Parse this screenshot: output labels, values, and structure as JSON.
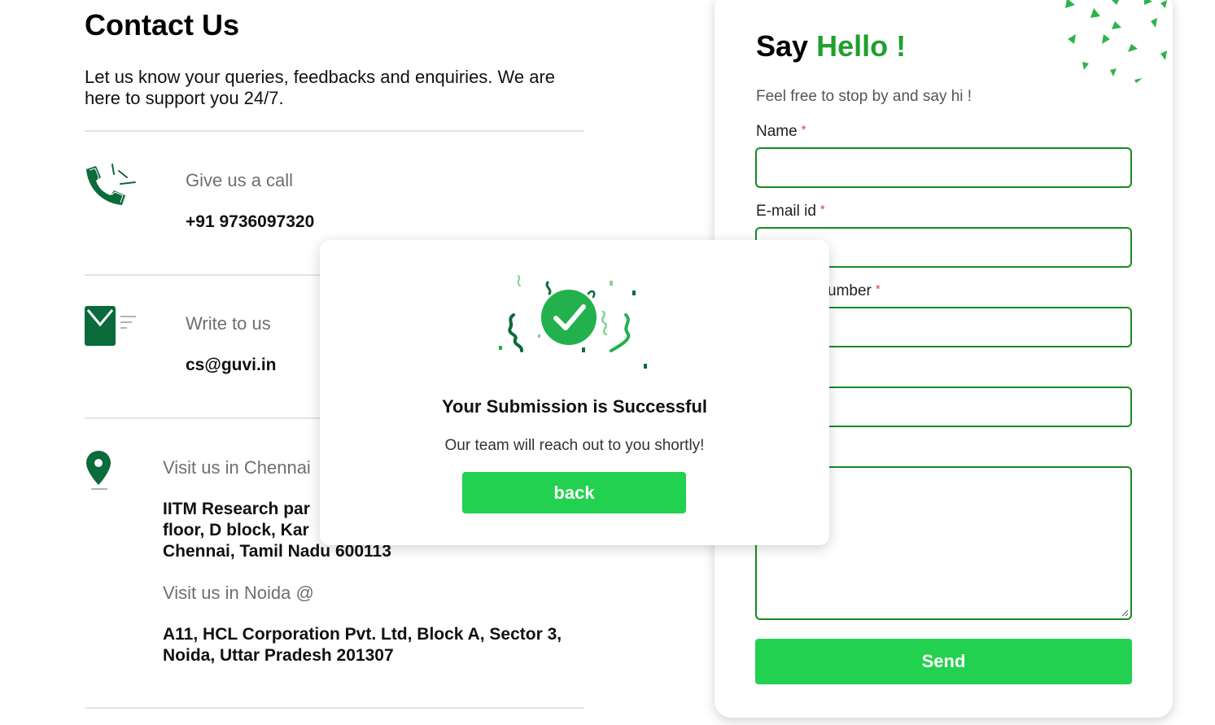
{
  "contact": {
    "title": "Contact Us",
    "intro": "Let us know your queries, feedbacks and enquiries. We are here to support you 24/7.",
    "call_label": "Give us a call",
    "call_value": "+91 9736097320",
    "write_label": "Write to us",
    "write_value": "cs@guvi.in",
    "chennai_label": "Visit us in Chennai",
    "chennai_address_line1": "IITM Research par",
    "chennai_address_line2": "floor, D block, Kar",
    "chennai_address_line3": "Chennai, Tamil Nadu 600113",
    "noida_label": "Visit us in Noida @",
    "noida_address": "A11, HCL Corporation Pvt. Ltd, Block A, Sector 3, Noida, Uttar Pradesh 201307"
  },
  "form": {
    "title_prefix": "Say",
    "title_accent": "Hello !",
    "subtitle": "Feel free to stop by and say hi !",
    "name_label": "Name",
    "email_label": "E-mail id",
    "phone_label_visible": "umber",
    "required_mark": "*",
    "send_label": "Send"
  },
  "modal": {
    "title": "Your Submission is Successful",
    "message": "Our team will reach out to you shortly!",
    "back_label": "back"
  },
  "colors": {
    "brand_green": "#22d14f",
    "dark_green": "#0b6b3a",
    "accent_green": "#1fa02f",
    "field_border": "#178a23"
  }
}
